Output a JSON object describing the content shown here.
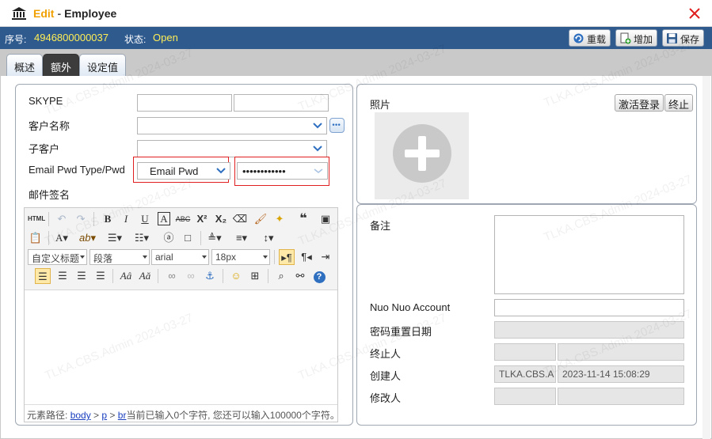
{
  "window": {
    "title_edit": "Edit",
    "title_sep": "-",
    "title_entity": "Employee"
  },
  "status": {
    "seq_label": "序号:",
    "seq_value": "4946800000037",
    "state_label": "状态:",
    "state_value": "Open",
    "buttons": {
      "reload": "重载",
      "add": "增加",
      "save": "保存"
    }
  },
  "tabs": [
    {
      "label": "概述",
      "active": false
    },
    {
      "label": "额外",
      "active": true
    },
    {
      "label": "设定值",
      "active": false
    }
  ],
  "form": {
    "skype_label": "SKYPE",
    "skype_value1": "",
    "skype_value2": "",
    "customer_label": "客户名称",
    "customer_value": "",
    "subcustomer_label": "子客户",
    "subcustomer_value": "",
    "email_pwd_label": "Email Pwd Type/Pwd",
    "email_pwd_type": "Email Pwd",
    "email_pwd_value": "••••••••••••",
    "signature_label": "邮件签名"
  },
  "editor": {
    "format_select": "自定义标题",
    "paragraph_select": "段落",
    "font_select": "arial",
    "size_select": "18px",
    "footer_prefix": "元素路径:",
    "path": [
      "body",
      "p",
      "br"
    ],
    "footer_suffix": "当前已输入0个字符, 您还可以输入100000个字符。"
  },
  "right": {
    "photo_label": "照片",
    "activate_login_button": "激活登录",
    "terminate_button": "终止",
    "remark_label": "备注",
    "nuo_label": "Nuo Nuo Account",
    "nuo_value": "",
    "pwd_reset_label": "密码重置日期",
    "pwd_reset_value": "",
    "terminator_label": "终止人",
    "terminator_value1": "",
    "terminator_value2": "",
    "creator_label": "创建人",
    "creator_user": "TLKA.CBS.A",
    "creator_time": "2023-11-14 15:08:29",
    "modifier_label": "修改人",
    "modifier_value1": "",
    "modifier_value2": ""
  },
  "watermark": "TLKA.CBS.Admin 2024-03-27",
  "colors": {
    "status_bar": "#2f5a8e",
    "status_value": "#ffee55",
    "title_edit": "#f0a000",
    "close_icon": "#e02020",
    "highlight_border": "#e02020"
  }
}
